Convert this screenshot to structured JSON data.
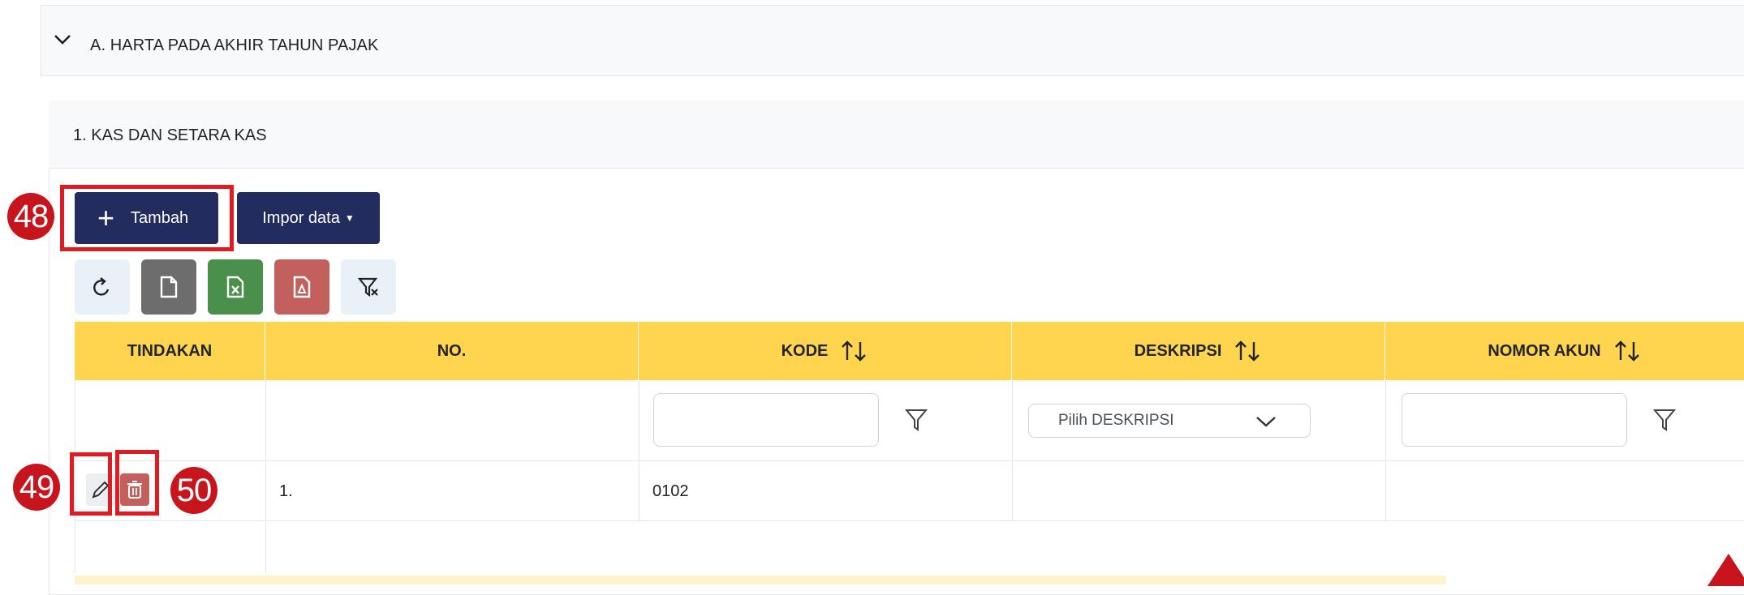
{
  "section": {
    "title": "A. HARTA PADA AKHIR TAHUN PAJAK"
  },
  "panel": {
    "title": "1. KAS DAN SETARA KAS"
  },
  "toolbar": {
    "add_label": "Tambah",
    "import_label": "Impor data"
  },
  "callouts": {
    "c48": "48",
    "c49": "49",
    "c50": "50"
  },
  "table": {
    "headers": {
      "tindakan": "TINDAKAN",
      "no": "NO.",
      "kode": "KODE",
      "deskripsi": "DESKRIPSI",
      "nomor_akun": "NOMOR AKUN"
    },
    "filters": {
      "deskripsi_placeholder": "Pilih DESKRIPSI"
    },
    "rows": [
      {
        "no": "1.",
        "kode": "0102",
        "deskripsi": "",
        "nomor_akun": ""
      }
    ]
  },
  "colors": {
    "navy": "#232c5e",
    "header_yellow": "#ffd54f",
    "callout_red": "#e11b22",
    "badge_red": "#c8141c"
  }
}
